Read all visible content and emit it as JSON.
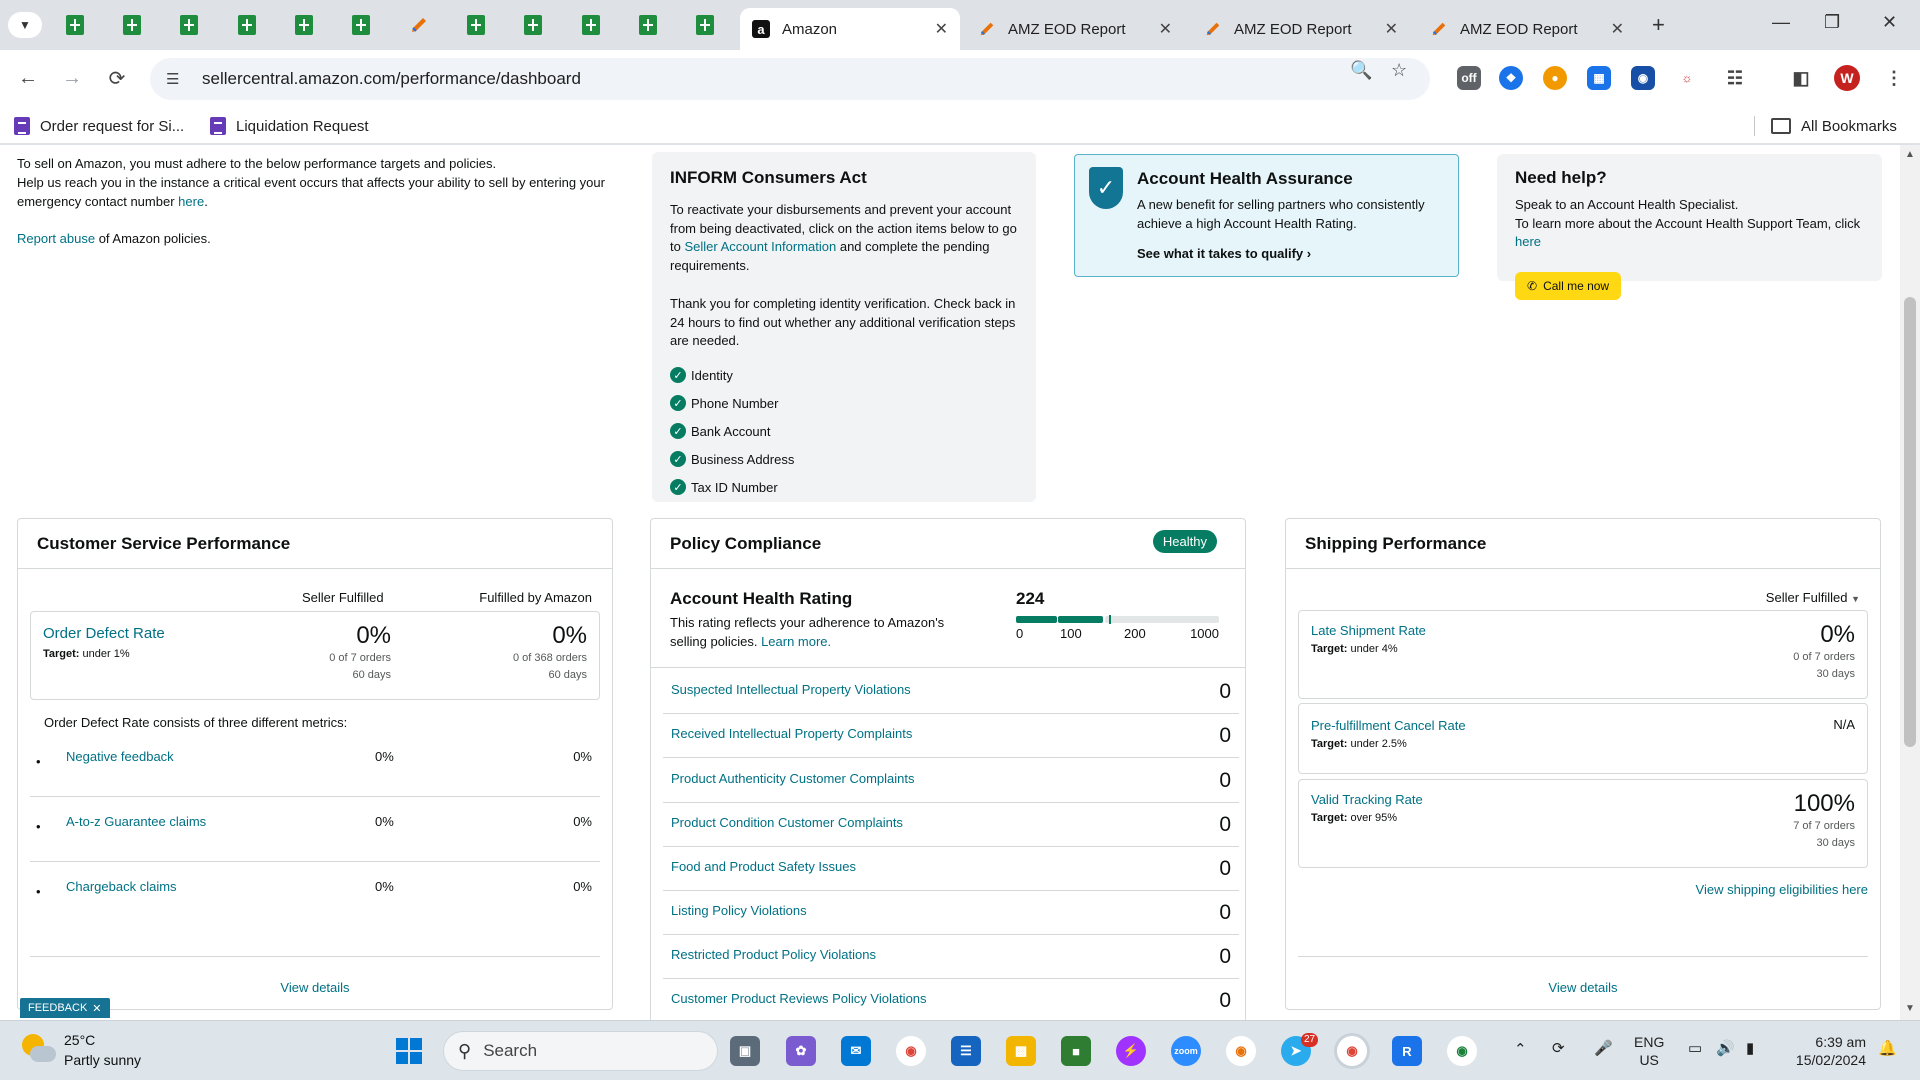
{
  "browser": {
    "tabs": [
      {
        "title": "Amazon",
        "active": true
      },
      {
        "title": "AMZ EOD Report",
        "active": false
      },
      {
        "title": "AMZ EOD Report",
        "active": false
      },
      {
        "title": "AMZ EOD Report",
        "active": false
      }
    ],
    "url": "sellercentral.amazon.com/performance/dashboard",
    "profile_initial": "W",
    "bookmarks": [
      "Order request for Si...",
      "Liquidation Request"
    ],
    "all_bookmarks": "All Bookmarks"
  },
  "intro": {
    "line1": "To sell on Amazon, you must adhere to the below performance targets and policies.",
    "line2": "Help us reach you in the instance a critical event occurs that affects your ability to sell by entering your emergency contact number",
    "here": "here",
    "period": ".",
    "report_link": "Report abuse",
    "report_rest": "of Amazon policies."
  },
  "inform": {
    "title": "INFORM Consumers Act",
    "para1_a": "To reactivate your disbursements and prevent your account from being deactivated, click on the action items below to go to",
    "para1_link": "Seller Account Information",
    "para1_b": "and complete the pending requirements.",
    "para2": "Thank you for completing identity verification. Check back in 24 hours to find out whether any additional verification steps are needed.",
    "checks": [
      "Identity",
      "Phone Number",
      "Bank Account",
      "Business Address",
      "Tax ID Number"
    ]
  },
  "aha": {
    "title": "Account Health Assurance",
    "text": "A new benefit for selling partners who consistently achieve a high Account Health Rating.",
    "link": "See what it takes to qualify"
  },
  "help": {
    "title": "Need help?",
    "line1": "Speak to an Account Health Specialist.",
    "line2": "To learn more about the Account Health Support Team, click",
    "here": "here",
    "button": "Call me now"
  },
  "customer_service": {
    "title": "Customer Service Performance",
    "col1": "Seller Fulfilled",
    "col2": "Fulfilled by Amazon",
    "odr": {
      "label": "Order Defect Rate",
      "target_label": "Target:",
      "target": "under 1%",
      "sf_pct": "0%",
      "sf_orders": "0 of 7 orders",
      "sf_days": "60 days",
      "fba_pct": "0%",
      "fba_orders": "0 of 368 orders",
      "fba_days": "60 days"
    },
    "consists": "Order Defect Rate consists of three different metrics:",
    "metrics": [
      {
        "name": "Negative feedback",
        "sf": "0%",
        "fba": "0%"
      },
      {
        "name": "A-to-z Guarantee claims",
        "sf": "0%",
        "fba": "0%"
      },
      {
        "name": "Chargeback claims",
        "sf": "0%",
        "fba": "0%"
      }
    ],
    "view_details": "View details"
  },
  "policy": {
    "title": "Policy Compliance",
    "badge": "Healthy",
    "ahr_title": "Account Health Rating",
    "ahr_text": "This rating reflects your adherence to Amazon's selling policies.",
    "learn_more": "Learn more.",
    "score": "224",
    "score_value": 224,
    "scale": [
      "0",
      "100",
      "200",
      "1000"
    ],
    "rows": [
      {
        "name": "Suspected Intellectual Property Violations",
        "count": "0"
      },
      {
        "name": "Received Intellectual Property Complaints",
        "count": "0"
      },
      {
        "name": "Product Authenticity Customer Complaints",
        "count": "0"
      },
      {
        "name": "Product Condition Customer Complaints",
        "count": "0"
      },
      {
        "name": "Food and Product Safety Issues",
        "count": "0"
      },
      {
        "name": "Listing Policy Violations",
        "count": "0"
      },
      {
        "name": "Restricted Product Policy Violations",
        "count": "0"
      },
      {
        "name": "Customer Product Reviews Policy Violations",
        "count": "0"
      }
    ]
  },
  "shipping": {
    "title": "Shipping Performance",
    "filter": "Seller Fulfilled",
    "late": {
      "label": "Late Shipment Rate",
      "target_label": "Target:",
      "target": "under 4%",
      "value": "0%",
      "orders": "0 of 7 orders",
      "days": "30 days"
    },
    "cancel": {
      "label": "Pre-fulfillment Cancel Rate",
      "target_label": "Target:",
      "target": "under 2.5%",
      "value": "N/A"
    },
    "tracking": {
      "label": "Valid Tracking Rate",
      "target_label": "Target:",
      "target": "over 95%",
      "value": "100%",
      "orders": "7 of 7 orders",
      "days": "30 days"
    },
    "eligibilities": "View shipping eligibilities here",
    "view_details": "View details"
  },
  "feedback": "FEEDBACK",
  "taskbar": {
    "temp": "25°C",
    "weather": "Partly sunny",
    "search": "Search",
    "lang1": "ENG",
    "lang2": "US",
    "time": "6:39 am",
    "date": "15/02/2024",
    "telegram_badge": "27"
  },
  "colors": {
    "healthy_green": "#067d62",
    "link_teal": "#007185",
    "call_yellow": "#ffd814",
    "aha_bg": "#e6f5f9"
  }
}
